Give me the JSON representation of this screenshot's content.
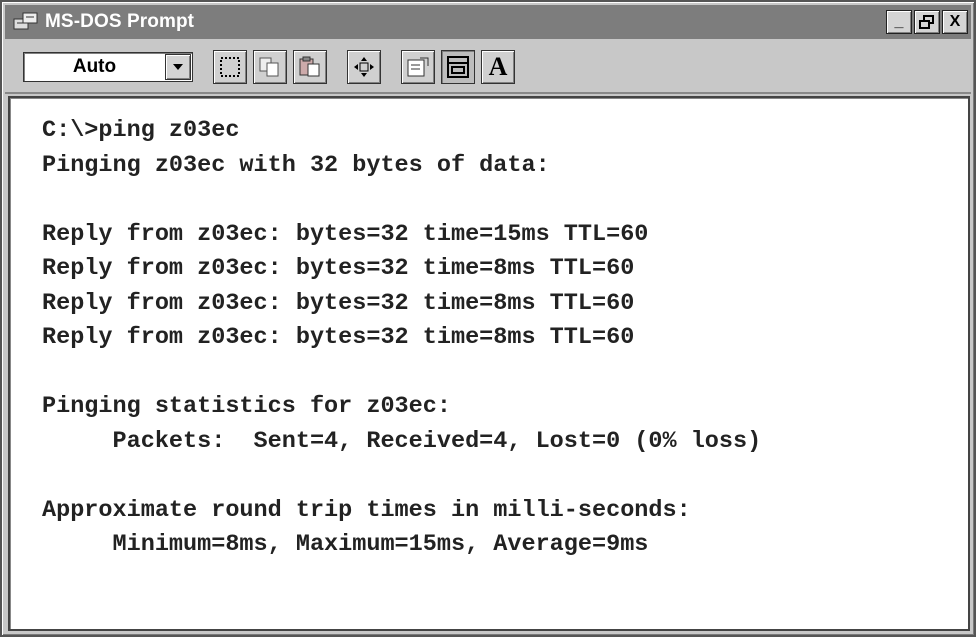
{
  "window": {
    "title": "MS-DOS Prompt",
    "buttons": {
      "minimize": "_",
      "restore": "❐",
      "close": "X"
    }
  },
  "toolbar": {
    "font_size": "Auto",
    "tools": [
      "mark-icon",
      "copy-icon",
      "paste-icon",
      "fullscreen-icon",
      "properties-icon",
      "background-icon",
      "font-icon"
    ],
    "font_button_label": "A"
  },
  "console": {
    "lines": [
      "C:\\>ping z03ec",
      "Pinging z03ec with 32 bytes of data:",
      "",
      "Reply from z03ec: bytes=32 time=15ms TTL=60",
      "Reply from z03ec: bytes=32 time=8ms TTL=60",
      "Reply from z03ec: bytes=32 time=8ms TTL=60",
      "Reply from z03ec: bytes=32 time=8ms TTL=60",
      "",
      "Pinging statistics for z03ec:",
      "     Packets:  Sent=4, Received=4, Lost=0 (0% loss)",
      "",
      "Approximate round trip times in milli-seconds:",
      "     Minimum=8ms, Maximum=15ms, Average=9ms"
    ]
  }
}
